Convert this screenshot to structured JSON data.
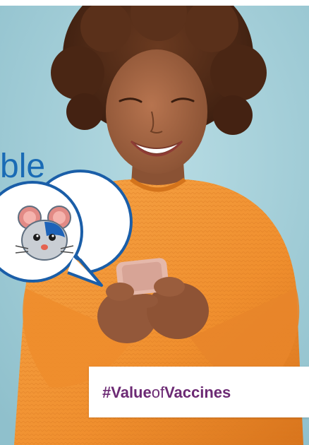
{
  "headline_fragment": "ble",
  "left_fragment": "",
  "hashtag": {
    "prefix": "#",
    "word1": "Value",
    "word2": "of",
    "word3": "Vaccines"
  },
  "icons": {
    "speech_bubble": "speech-bubble-icon",
    "mascot": "mouse-icon"
  },
  "colors": {
    "background": "#a9d3dc",
    "headline_blue": "#1a6bb5",
    "sweater_orange": "#f39a3c",
    "hashtag_purple": "#6c2a74",
    "bubble_border": "#1a5ea8"
  }
}
